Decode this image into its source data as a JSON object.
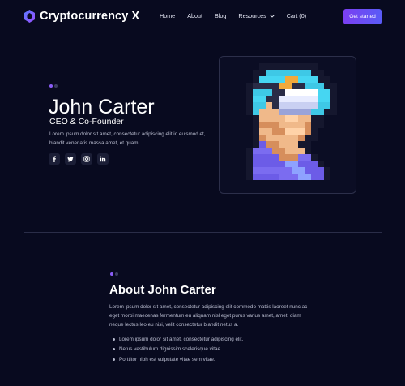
{
  "header": {
    "logo_text": "Cryptocurrency X",
    "nav": [
      {
        "label": "Home"
      },
      {
        "label": "About"
      },
      {
        "label": "Blog"
      },
      {
        "label": "Resources",
        "has_dropdown": true
      },
      {
        "label": "Cart (0)"
      }
    ],
    "cta_label": "Get started"
  },
  "hero": {
    "name": "John Carter",
    "role": "CEO & Co-Founder",
    "description": "Lorem ipsum dolor sit amet, consectetur adipiscing elit id euismod et, blandit venenatis massa amet, et quam.",
    "socials": [
      {
        "icon": "facebook-icon"
      },
      {
        "icon": "twitter-icon"
      },
      {
        "icon": "instagram-icon"
      },
      {
        "icon": "linkedin-icon"
      }
    ]
  },
  "about": {
    "title": "About John Carter",
    "text": "Lorem ipsum dolor sit amet, consectetur adipiscing elit commodo mattis laoreet nunc ac eget morbi maecenas fermentum eu aliquam nisl eget purus varius amet, amet, diam neque lectus leo eu nisi, velit consectetur blandit netus a.",
    "bullets": [
      "Lorem ipsum dolor sit amet, consectetur adipiscing elit.",
      "Netus vestibulum dignissim scelerisque vitae.",
      "Porttitor nibh est vulputate vitae sem vitae."
    ]
  },
  "colors": {
    "background": "#080a1f",
    "accent_start": "#7b3ff2",
    "accent_end": "#5a5bf6",
    "muted_text": "#b9bccf"
  }
}
